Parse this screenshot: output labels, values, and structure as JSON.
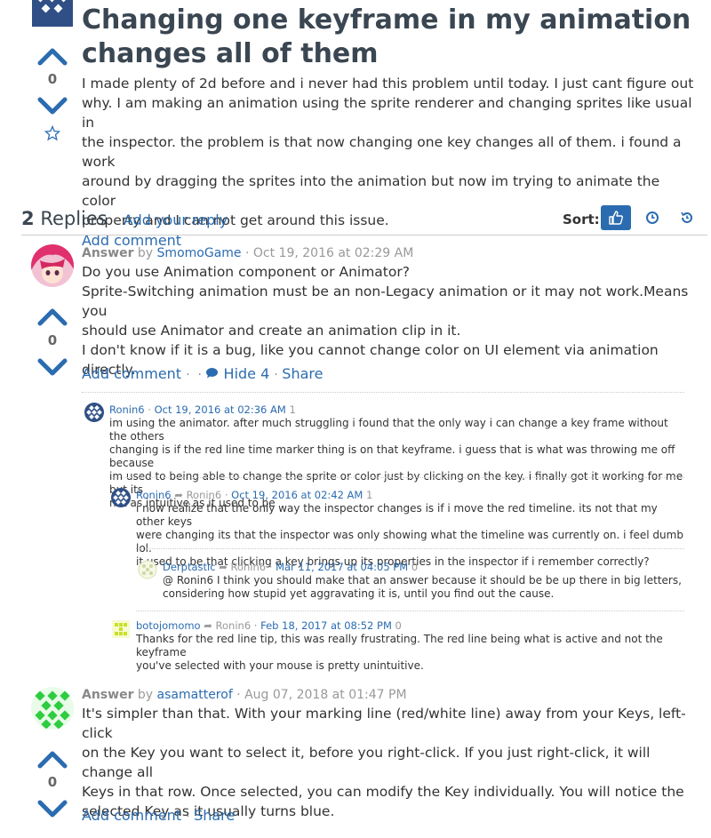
{
  "question": {
    "title_line1": "Changing one keyframe in my animation",
    "title_line2": "changes all of them",
    "votes": "0",
    "body": [
      "I made plenty of 2d before and i never had this problem until today. I just cant figure out",
      "why. I am making an animation using the sprite renderer and changing sprites like usual in",
      "the inspector. the problem is that now changing one key changes all of them. i found a work",
      "around by dragging the sprites into the animation but now im trying to animate the color",
      "property and I can not get around this issue."
    ],
    "add_comment": "Add comment"
  },
  "replies_bar": {
    "count": "2",
    "label": "Replies",
    "sep": "·",
    "add_reply": "Add your reply",
    "sort_label": "Sort:"
  },
  "answers": [
    {
      "kind": "Answer",
      "by": "by",
      "user": "SmomoGame",
      "date": "· Oct 19, 2016 at 02:29 AM",
      "votes": "0",
      "body": [
        "Do you use Animation component or Animator?",
        "Sprite-Switching animation must be an non-Legacy animation or it may not work.Means you",
        "should use Animator and create an animation clip in it.",
        "I don't know if it is a bug, like you cannot change color on UI element via animation directly."
      ],
      "add_comment": "Add comment",
      "hide": "Hide 4",
      "share": "Share"
    },
    {
      "kind": "Answer",
      "by": "by",
      "user": "asamatterof",
      "date": "· Aug 07, 2018 at 01:47 PM",
      "votes": "0",
      "body": [
        "It's simpler than that. With your marking line (red/white line) away from your Keys, left-click",
        "on the Key you want to select it, before you right-click. If you just right-click, it will change all",
        "Keys in that row. Once selected, you can modify the Key individually. You will notice the",
        "selected Key as it usually turns blue."
      ],
      "add_comment": "Add comment",
      "share": "Share"
    }
  ],
  "comments": [
    {
      "user": "Ronin6",
      "reply_to": "",
      "date": "Oct 19, 2016 at 02:36 AM",
      "score": "1",
      "lines": [
        "im using the animator. after much struggling i found that the only way i can change a key frame without the others",
        "changing is if the red line time marker thing is on that keyframe. i guess that is what was throwing me off because",
        "im used to being able to change the sprite or color just by clicking on the key. i finally got it working for me but its",
        "not as intuitive as it used to be"
      ]
    },
    {
      "user": "Ronin6",
      "reply_to": "Ronin6",
      "date": "Oct 19, 2016 at 02:42 AM",
      "score": "1",
      "lines": [
        "i now realize that the only way the inspector changes is if i move the red timeline. its not that my other keys",
        "were changing its that the inspector was only showing what the timeline was currently on. i feel dumb lol.",
        "it used to be that clicking a key brings up its properties in the inspector if i remember correctly?"
      ]
    },
    {
      "user": "Derptastic",
      "reply_to": "Ronin6",
      "date": "Mar 11, 2017 at 04:05 PM",
      "score": "0",
      "lines": [
        "@ Ronin6 I think you should make that an answer because it should be be up there in big letters,",
        "considering how stupid yet aggravating it is, until you find out the cause."
      ]
    },
    {
      "user": "botojomomo",
      "reply_to": "Ronin6",
      "date": "Feb 18, 2017 at 08:52 PM",
      "score": "0",
      "lines": [
        "Thanks for the red line tip, this was really frustrating. The red line being what is active and not the keyframe",
        "you've selected with your mouse is pretty unintuitive."
      ]
    }
  ],
  "colors": {
    "accent": "#2b6cb0",
    "vote_arrow": "#2b6cb0",
    "title": "#3a4651",
    "sort_active_bg": "#2b6cb0"
  }
}
